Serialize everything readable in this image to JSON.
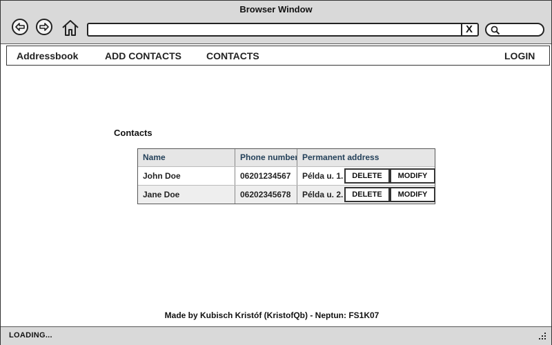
{
  "browser": {
    "title": "Browser Window",
    "address_value": "",
    "clear_glyph": "X"
  },
  "menu": {
    "brand": "Addressbook",
    "add_contacts": "ADD CONTACTS",
    "contacts": "CONTACTS",
    "login": "LOGIN"
  },
  "page": {
    "heading": "Contacts"
  },
  "table": {
    "headers": [
      "Name",
      "Phone number",
      "Permanent address"
    ],
    "rows": [
      {
        "name": "John Doe",
        "phone": "06201234567",
        "address": "Példa u. 1.",
        "delete": "DELETE",
        "modify": "MODIFY"
      },
      {
        "name": "Jane Doe",
        "phone": "06202345678",
        "address": "Példa u. 2.",
        "delete": "DELETE",
        "modify": "MODIFY"
      }
    ]
  },
  "footer": {
    "text": "Made by Kubisch Kristóf (KristofQb) - Neptun: FS1K07"
  },
  "status": {
    "text": "LOADING..."
  },
  "icons": {
    "back": "back-arrow-icon",
    "forward": "forward-arrow-icon",
    "home": "home-icon",
    "search": "search-icon",
    "resize": "resize-grip-icon"
  }
}
